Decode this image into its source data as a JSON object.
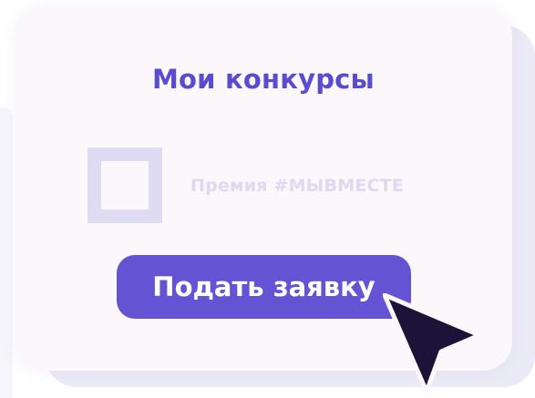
{
  "card": {
    "title": "Мои конкурсы"
  },
  "item": {
    "label": "Премия #МЫВМЕСТЕ"
  },
  "actions": {
    "submit_label": "Подать заявку"
  },
  "icons": {
    "checkbox": "checkbox-icon",
    "cursor": "mouse-pointer-icon"
  },
  "colors": {
    "accent": "#6453d3",
    "title": "#5a4bd0",
    "card_background": "#fcf7fa",
    "muted": "#ddd9f2",
    "cursor": "#1c1338"
  }
}
